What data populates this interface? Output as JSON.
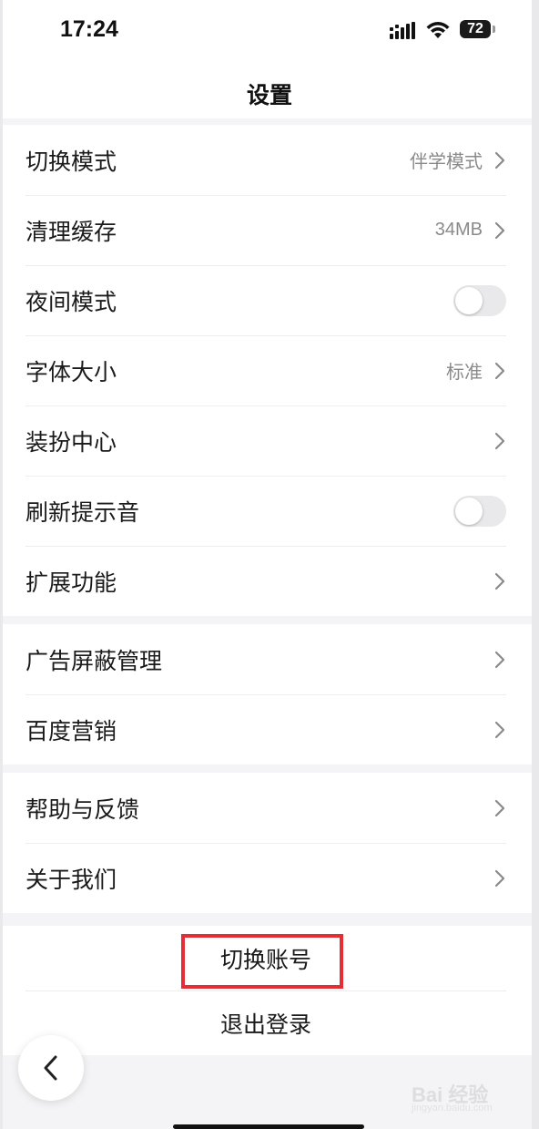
{
  "status_bar": {
    "time": "17:24",
    "battery": "72"
  },
  "nav": {
    "title": "设置"
  },
  "group1": [
    {
      "label": "切换模式",
      "value": "伴学模式",
      "control": "chevron"
    },
    {
      "label": "清理缓存",
      "value": "34MB",
      "control": "chevron"
    },
    {
      "label": "夜间模式",
      "value": "",
      "control": "toggle",
      "on": false
    },
    {
      "label": "字体大小",
      "value": "标准",
      "control": "chevron"
    },
    {
      "label": "装扮中心",
      "value": "",
      "control": "chevron"
    },
    {
      "label": "刷新提示音",
      "value": "",
      "control": "toggle",
      "on": false
    },
    {
      "label": "扩展功能",
      "value": "",
      "control": "chevron"
    }
  ],
  "group2": [
    {
      "label": "广告屏蔽管理",
      "control": "chevron"
    },
    {
      "label": "百度营销",
      "control": "chevron"
    }
  ],
  "group3": [
    {
      "label": "帮助与反馈",
      "control": "chevron"
    },
    {
      "label": "关于我们",
      "control": "chevron"
    }
  ],
  "actions": {
    "switch_account": "切换账号",
    "logout": "退出登录"
  },
  "highlight_color": "#e52d36",
  "watermark": {
    "text": "Bai 经验",
    "sub": "jingyan.baidu.com"
  }
}
